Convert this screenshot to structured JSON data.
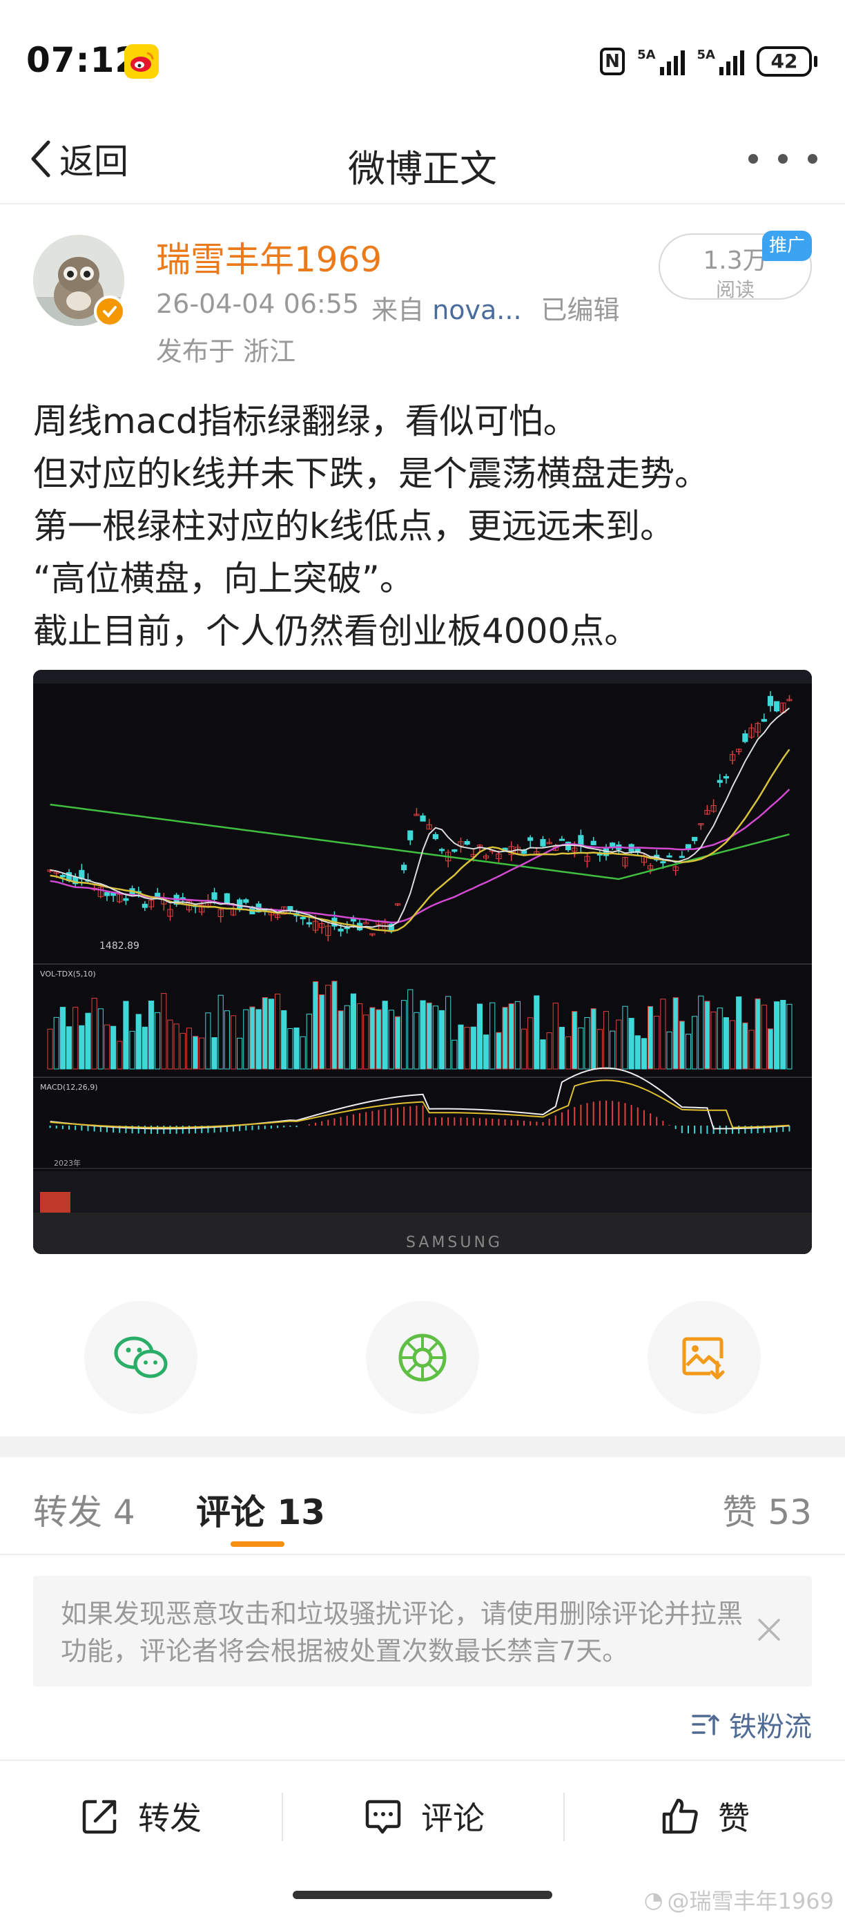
{
  "status_bar": {
    "time": "07:12",
    "network_1": "5A",
    "network_2": "5A",
    "battery": "42"
  },
  "nav": {
    "back_label": "返回",
    "title": "微博正文"
  },
  "post": {
    "author": "瑞雪丰年1969",
    "date": "26-04-04 06:55",
    "source_prefix": "来自",
    "source": "nova...",
    "edited": "已编辑",
    "region": "发布于 浙江",
    "reads_count": "1.3万",
    "reads_label": "阅读",
    "promo_tag": "推广",
    "lines": [
      "周线macd指标绿翻绿，看似可怕。",
      "但对应的k线并未下跌，是个震荡横盘走势。",
      "第一根绿柱对应的k线低点，更远远未到。",
      "“高位横盘，向上突破”。",
      "截止目前，个人仍然看创业板4000点。"
    ],
    "image": {
      "low_label": "1482.89",
      "vol_label": "VOL-TDX(5,10)",
      "macd_label": "MACD(12,26,9)",
      "year_label": "2023年",
      "device_label": "SAMSUNG"
    }
  },
  "share": [
    {
      "name": "wechat",
      "icon": "wechat-icon"
    },
    {
      "name": "moments",
      "icon": "moments-icon"
    },
    {
      "name": "save-image",
      "icon": "save-image-icon"
    }
  ],
  "tabs": {
    "repost": "转发 4",
    "comment": "评论 13",
    "like": "赞 53"
  },
  "notice": {
    "text": "如果发现恶意攻击和垃圾骚扰评论，请使用删除评论并拉黑功能，评论者将会根据被处置次数最长禁言7天。"
  },
  "sort": {
    "label": "铁粉流"
  },
  "actions": {
    "repost": "转发",
    "comment": "评论",
    "like": "赞"
  },
  "watermark": "@瑞雪丰年1969",
  "colors": {
    "author": "#eb7a1b",
    "accent": "#f78f12",
    "link": "#4f6a93",
    "promo": "#3ba3f1"
  }
}
